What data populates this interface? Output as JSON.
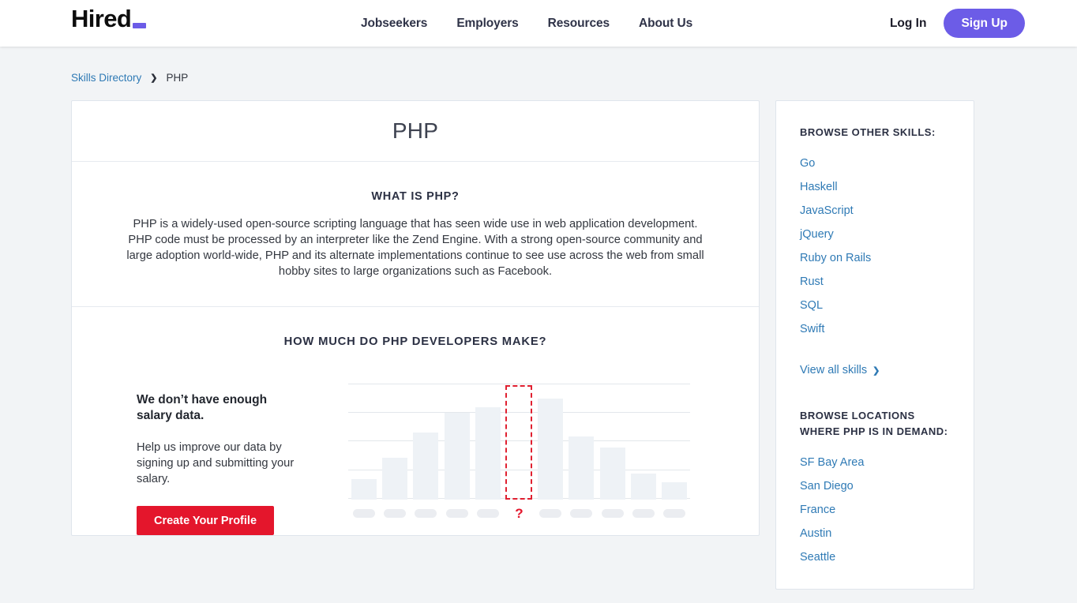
{
  "header": {
    "logo_text": "Hired",
    "nav": [
      {
        "label": "Jobseekers"
      },
      {
        "label": "Employers"
      },
      {
        "label": "Resources"
      },
      {
        "label": "About Us"
      }
    ],
    "login_label": "Log In",
    "signup_label": "Sign Up",
    "accent_color": "#6c5ce7"
  },
  "breadcrumb": {
    "parent": "Skills Directory",
    "separator": "❯",
    "current": "PHP"
  },
  "main": {
    "page_title": "PHP",
    "about_heading": "WHAT IS PHP?",
    "about_text": "PHP is a widely-used open-source scripting language that has seen wide use in web application development. PHP code must be processed by an interpreter like the Zend Engine. With a strong open-source community and large adoption world-wide, PHP and its alternate implementations continue to see use across the web from small hobby sites to large organizations such as Facebook.",
    "salary_heading": "HOW MUCH DO PHP DEVELOPERS MAKE?",
    "no_data_title": "We don’t have enough salary data.",
    "no_data_sub": "Help us improve our data by signing up and submitting your salary.",
    "cta_label": "Create Your Profile",
    "cta_color": "#e4162c"
  },
  "chart_data": {
    "type": "bar",
    "title": "HOW MUCH DO PHP DEVELOPERS MAKE?",
    "xlabel": "",
    "ylabel": "",
    "grid": true,
    "legend": false,
    "note": "Placeholder salary distribution histogram; bar and tick labels are obscured. The 6th bin is highlighted with a red dashed outline and a '?' label indicating missing salary data.",
    "categories": [
      "",
      "",
      "",
      "",
      "",
      "?",
      "",
      "",
      "",
      "",
      ""
    ],
    "values": [
      18,
      37,
      58,
      75,
      80,
      0,
      88,
      55,
      45,
      23,
      15
    ],
    "ylim": [
      0,
      100
    ],
    "gridline_values": [
      100,
      75,
      50,
      25,
      0
    ],
    "highlight": {
      "index": 5,
      "label": "?",
      "color": "#e02030",
      "style": "dashed-outline",
      "height": 100
    },
    "bar_color": "#eef2f6",
    "tick_placeholder_color": "#ebedf1"
  },
  "sidebar": {
    "skills_heading": "BROWSE OTHER SKILLS:",
    "skills": [
      {
        "label": "Go"
      },
      {
        "label": "Haskell"
      },
      {
        "label": "JavaScript"
      },
      {
        "label": "jQuery"
      },
      {
        "label": "Ruby on Rails"
      },
      {
        "label": "Rust"
      },
      {
        "label": "SQL"
      },
      {
        "label": "Swift"
      }
    ],
    "view_all_label": "View all skills",
    "view_all_chevron": "❯",
    "locations_heading": "BROWSE LOCATIONS WHERE PHP IS IN DEMAND:",
    "locations": [
      {
        "label": "SF Bay Area"
      },
      {
        "label": "San Diego"
      },
      {
        "label": "France"
      },
      {
        "label": "Austin"
      },
      {
        "label": "Seattle"
      }
    ],
    "link_color": "#2f7ab5"
  }
}
